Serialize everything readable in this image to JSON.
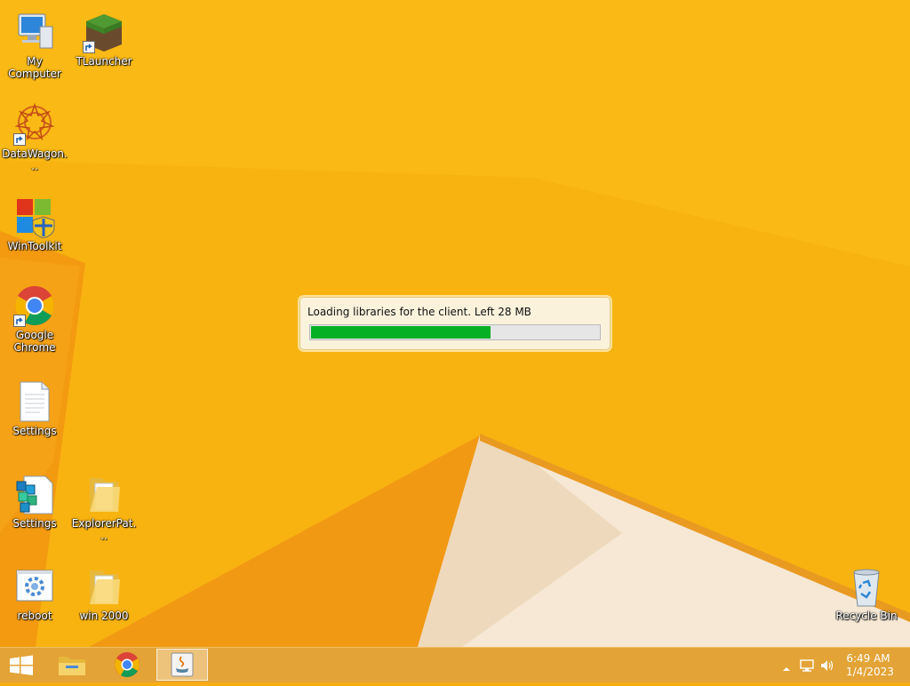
{
  "desktop_icons": [
    {
      "label": "My Computer",
      "icon": "computer-icon"
    },
    {
      "label": "TLauncher",
      "icon": "grass-block-icon"
    },
    {
      "label": "DataWagon...",
      "icon": "mandala-icon"
    },
    {
      "label": "WinToolkit",
      "icon": "windows-shield-icon"
    },
    {
      "label": "Google Chrome",
      "icon": "chrome-icon"
    },
    {
      "label": "Settings",
      "icon": "document-icon"
    },
    {
      "label": "Settings",
      "icon": "registry-icon"
    },
    {
      "label": "ExplorerPat...",
      "icon": "folder-icon"
    },
    {
      "label": "reboot",
      "icon": "gear-window-icon"
    },
    {
      "label": "win 2000",
      "icon": "folder-icon"
    },
    {
      "label": "Recycle Bin",
      "icon": "recycle-bin-icon"
    }
  ],
  "dialog": {
    "message": "Loading libraries for the client. Left 28 MB",
    "progress": 0.625
  },
  "taskbar": {
    "items": [
      {
        "name": "file-explorer",
        "icon": "folder-icon"
      },
      {
        "name": "chrome",
        "icon": "chrome-icon"
      },
      {
        "name": "java",
        "icon": "java-icon",
        "active": true
      }
    ],
    "clock": {
      "time": "6:49 AM",
      "date": "1/4/2023"
    }
  },
  "colors": {
    "wallpaper": "#f8ae10",
    "progress_fill": "#06b025",
    "taskbar": "#e3a336"
  }
}
